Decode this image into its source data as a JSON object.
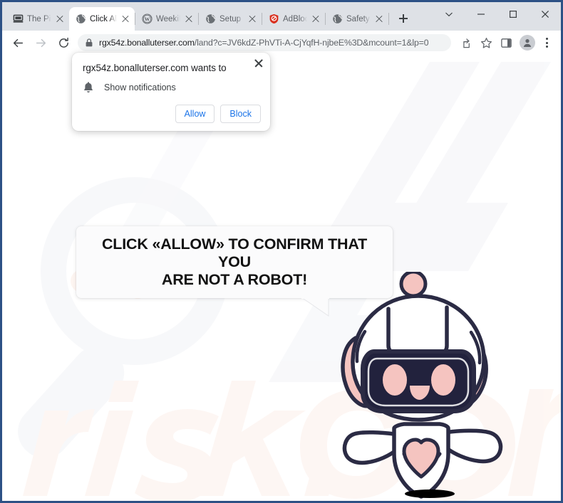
{
  "browser": {
    "tabs": [
      {
        "title": "The Pir",
        "favicon": "computer-icon",
        "active": false
      },
      {
        "title": "Click Al",
        "favicon": "globe-icon",
        "active": true
      },
      {
        "title": "WeekiP",
        "favicon": "wordpress-icon",
        "active": false
      },
      {
        "title": "Setup F",
        "favicon": "globe-icon",
        "active": false
      },
      {
        "title": "AdBloc",
        "favicon": "adblock-shield-icon",
        "active": false
      },
      {
        "title": "Safety [",
        "favicon": "globe-icon",
        "active": false
      }
    ],
    "new_tab_label": "+",
    "window_controls": {
      "tab_search": "chevron-down-icon",
      "minimize": "minimize-icon",
      "maximize": "maximize-icon",
      "close": "close-icon"
    },
    "nav": {
      "back": "back-arrow-icon",
      "forward": "forward-arrow-icon",
      "reload": "reload-icon"
    },
    "omnibox": {
      "lock": "lock-icon",
      "host": "rgx54z.bonalluterser.com",
      "path": "/land?c=JV6kdZ-PhVTi-A-CjYqfH-njbeE%3D&mcount=1&lp=0",
      "full_url": "rgx54z.bonalluterser.com/land?c=JV6kdZ-PhVTi-A-CjYqfH-njbeE%3D&mcount=1&lp=0"
    },
    "toolbar_icons": {
      "share": "share-icon",
      "bookmark": "star-icon",
      "side_panel": "side-panel-icon",
      "profile": "profile-avatar-icon",
      "menu": "kebab-menu-icon"
    }
  },
  "notification_popup": {
    "title": "rgx54z.bonalluterser.com wants to",
    "permission_icon": "bell-icon",
    "permission_label": "Show notifications",
    "allow_label": "Allow",
    "block_label": "Block",
    "close_icon": "close-icon",
    "accent_color": "#1a73e8"
  },
  "page": {
    "bubble_text_line1": "CLICK «ALLOW» TO CONFIRM THAT YOU",
    "bubble_text_line2": "ARE NOT A ROBOT!",
    "bubble_text_full": "CLICK «ALLOW» TO CONFIRM THAT YOU ARE NOT A ROBOT!",
    "mascot": "robot-mascot-illustration",
    "watermark_text": "pcrisk.com",
    "colors": {
      "robot_outline": "#2b2b44",
      "robot_accent": "#f5c4c0",
      "robot_face": "#22223d",
      "page_background": "#ffffff",
      "bubble_background": "#fbfbfc"
    }
  }
}
